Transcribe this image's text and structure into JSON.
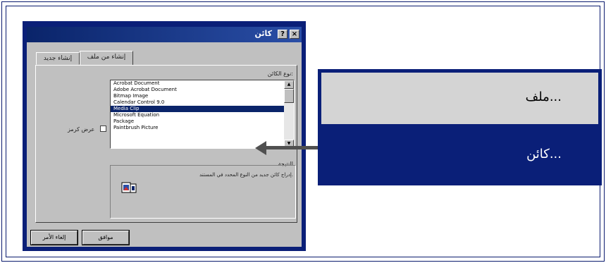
{
  "dialog": {
    "title": "كائن",
    "help_glyph": "?",
    "close_glyph": "×",
    "tabs": [
      "إنشاء جديد",
      "إنشاء من ملف"
    ],
    "object_type_label": "نوع الكائن:",
    "object_types": [
      "Acrobat Document",
      "Adobe Acrobat Document",
      "Bitmap Image",
      "Calendar Control 9.0",
      "Media Clip",
      "Microsoft Equation",
      "Package",
      "Paintbrush Picture"
    ],
    "selected_index": 4,
    "display_as_icon_label": "عرض كرمز",
    "result_label": "النتيجة",
    "result_text": "إدراج كائن جديد من النوع المحدد في المستند.",
    "ok_label": "موافق",
    "cancel_label": "إلغاء الأمر"
  },
  "menu": {
    "items": [
      "ملف...",
      "كائن..."
    ]
  },
  "colors": {
    "frame": "#0a1a6e",
    "menu_highlight": "#0a1f78",
    "menu_item_bg": "#d4d4d4",
    "dialog_face": "#c0c0c0",
    "arrow": "#505050"
  }
}
